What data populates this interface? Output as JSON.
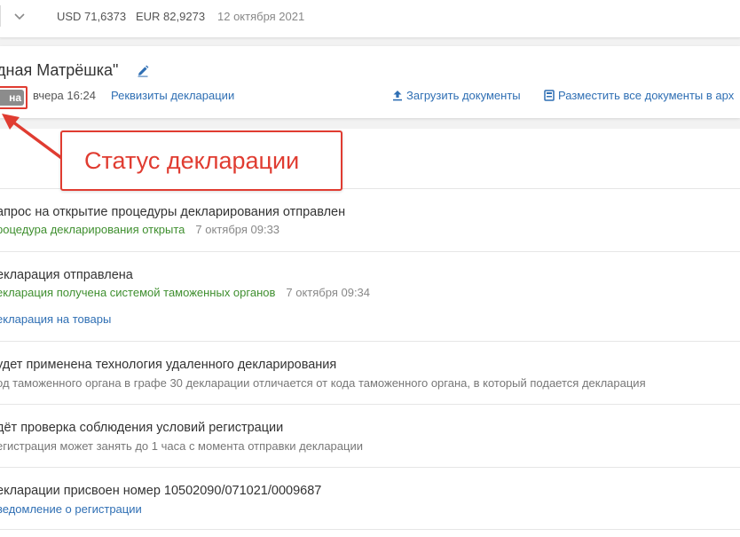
{
  "topbar": {
    "usd": "USD 71,6373",
    "eur": "EUR 82,9273",
    "date": "12 октября 2021"
  },
  "declaration": {
    "title": "дная Матрёшка\"",
    "status_label": "на",
    "time": "вчера 16:24",
    "requisites_link": "Реквизиты декларации",
    "upload_link": "Загрузить документы",
    "archive_link": "Разместить все документы в арх"
  },
  "annotation": {
    "label": "Статус декларации"
  },
  "events": [
    {
      "title": "апрос на открытие процедуры декларирования отправлен",
      "status": "роцедура декларирования открыта",
      "time": "7 октября 09:33"
    },
    {
      "title": "екларация отправлена",
      "status": "екларация получена системой таможенных органов",
      "time": "7 октября 09:34",
      "link": "екларация на товары"
    },
    {
      "title": "удет применена технология удаленного декларирования",
      "note": "од таможенного органа в графе 30 декларации отличается от кода таможенного органа, в который подается декларация"
    },
    {
      "title": "дёт проверка соблюдения условий регистрации",
      "note": "егистрация может занять до 1 часа с момента отправки декларации"
    },
    {
      "title": "екларации присвоен номер 10502090/071021/0009687",
      "link": "ведомление о регистрации"
    }
  ],
  "colors": {
    "accent_red": "#e03c31",
    "link_blue": "#2f6fb4",
    "success_green": "#3f8f2f",
    "status_gray": "#8c8c8c"
  },
  "icons": {
    "dropdown": "chevron-down-icon",
    "edit": "pencil-icon",
    "upload": "upload-icon",
    "archive": "archive-icon"
  }
}
